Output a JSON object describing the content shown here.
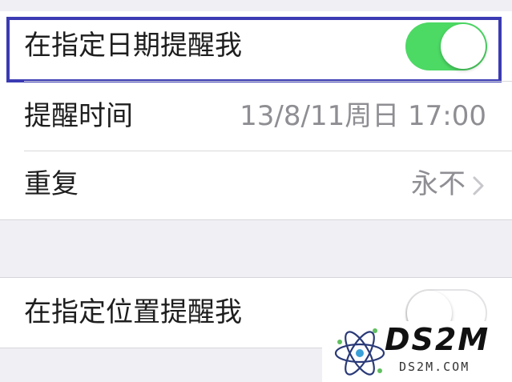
{
  "settings": {
    "date_reminder": {
      "label": "在指定日期提醒我",
      "enabled": true
    },
    "reminder_time": {
      "label": "提醒时间",
      "value": "13/8/11周日 17:00"
    },
    "repeat": {
      "label": "重复",
      "value": "永不"
    },
    "location_reminder": {
      "label": "在指定位置提醒我",
      "enabled": false
    }
  },
  "colors": {
    "toggle_on": "#4cd964",
    "highlight": "#3b3ab3",
    "background": "#efeff4",
    "value_text": "#8e8e93"
  },
  "icons": {
    "chevron": "chevron-right-icon",
    "watermark_logo": "atom-logo"
  },
  "watermark": {
    "title": "DS2M",
    "url": "DS2M.COM"
  }
}
